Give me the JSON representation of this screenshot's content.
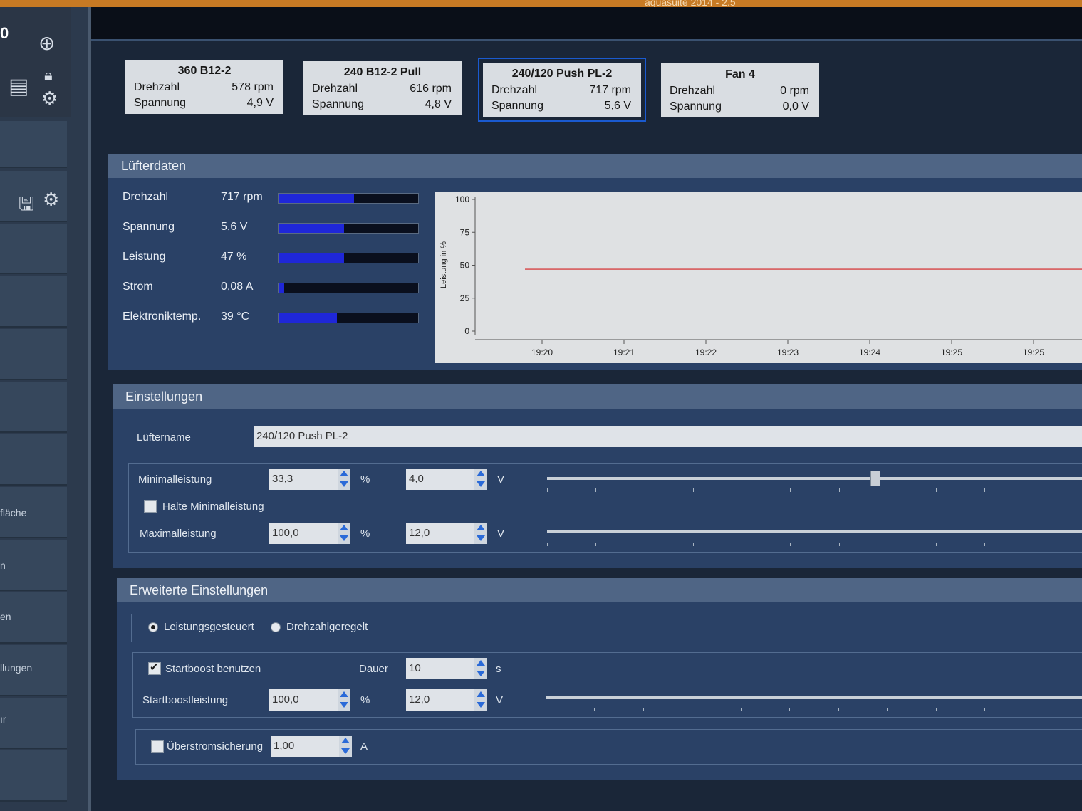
{
  "window": {
    "title": "aquasuite 2014 - 2.5"
  },
  "sidebar": {
    "counter": "0",
    "items": [
      "fläche",
      "n",
      "en",
      "llungen",
      "ır"
    ]
  },
  "fans": [
    {
      "name": "360 B12-2",
      "speed_label": "Drehzahl",
      "speed": "578 rpm",
      "voltage_label": "Spannung",
      "voltage": "4,9 V"
    },
    {
      "name": "240 B12-2 Pull",
      "speed_label": "Drehzahl",
      "speed": "616 rpm",
      "voltage_label": "Spannung",
      "voltage": "4,8 V"
    },
    {
      "name": "240/120 Push PL-2",
      "speed_label": "Drehzahl",
      "speed": "717 rpm",
      "voltage_label": "Spannung",
      "voltage": "5,6 V"
    },
    {
      "name": "Fan 4",
      "speed_label": "Drehzahl",
      "speed": "0 rpm",
      "voltage_label": "Spannung",
      "voltage": "0,0 V"
    }
  ],
  "fan_data": {
    "title": "Lüfterdaten",
    "rows": [
      {
        "label": "Drehzahl",
        "value": "717 rpm",
        "level": 0.54
      },
      {
        "label": "Spannung",
        "value": "5,6 V",
        "level": 0.47
      },
      {
        "label": "Leistung",
        "value": "47 %",
        "level": 0.47
      },
      {
        "label": "Strom",
        "value": "0,08 A",
        "level": 0.04
      },
      {
        "label": "Elektroniktemp.",
        "value": "39 °C",
        "level": 0.42
      }
    ]
  },
  "chart_data": {
    "type": "line",
    "ylabel": "Leistung in %",
    "ylim": [
      0,
      100
    ],
    "yticks": [
      "100",
      "75",
      "50",
      "25",
      "0"
    ],
    "x": [
      "19:20",
      "19:21",
      "19:22",
      "19:23",
      "19:24",
      "19:25",
      "19:25"
    ],
    "series": [
      {
        "values": [
          47,
          47,
          47,
          47,
          47,
          47,
          47
        ],
        "color": "#d42020"
      }
    ]
  },
  "settings": {
    "title": "Einstellungen",
    "fan_name_label": "Lüftername",
    "fan_name_value": "240/120 Push PL-2",
    "min_label": "Minimalleistung",
    "min_percent": "33,3",
    "min_volt": "4,0",
    "min_level": 0.333,
    "hold_min_label": "Halte Minimalleistung",
    "max_label": "Maximalleistung",
    "max_percent": "100,0",
    "max_volt": "12,0",
    "percent_unit": "%",
    "volt_unit": "V"
  },
  "advanced": {
    "title": "Erweiterte Einstellungen",
    "mode_power": "Leistungsgesteuert",
    "mode_speed": "Drehzahlgeregelt",
    "startboost_label": "Startboost benutzen",
    "duration_label": "Dauer",
    "duration_value": "10",
    "duration_unit": "s",
    "boost_power_label": "Startboostleistung",
    "boost_percent": "100,0",
    "boost_volt": "12,0",
    "overcurrent_label": "Überstromsicherung",
    "overcurrent_value": "1,00",
    "ampere_unit": "A"
  },
  "colors": {
    "accent": "#1a5ad0",
    "bar_fill": "#1f27d8",
    "chart_line": "#d42020",
    "panel": "#2a4166"
  }
}
